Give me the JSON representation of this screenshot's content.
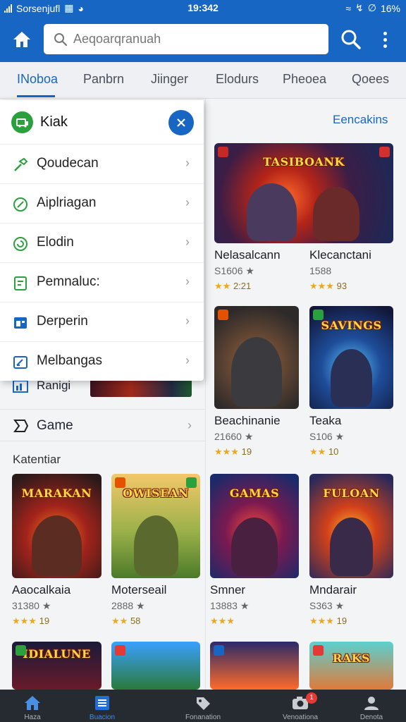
{
  "status_bar": {
    "carrier": "Sorsenjufl",
    "time": "19:342",
    "battery": "16%"
  },
  "search": {
    "placeholder": "Aeqoarqranuah"
  },
  "tabs": [
    {
      "label": "INoboa",
      "active": true
    },
    {
      "label": "Panbrn"
    },
    {
      "label": "Jiinger"
    },
    {
      "label": "Elodurs"
    },
    {
      "label": "Pheoea"
    },
    {
      "label": "Qoees"
    }
  ],
  "dropdown": {
    "title": "Kiak",
    "items": [
      {
        "label": "Qoudecan",
        "icon": "hammer-icon"
      },
      {
        "label": "Aiplriagan",
        "icon": "slash-circle-icon"
      },
      {
        "label": "Elodin",
        "icon": "refresh-circle-icon"
      },
      {
        "label": "Pemnaluc:",
        "icon": "document-icon"
      },
      {
        "label": "Derperin",
        "icon": "window-icon"
      },
      {
        "label": "Melbangas",
        "icon": "edit-icon"
      }
    ]
  },
  "left_list": {
    "partial_label": "Ranigi",
    "game_label": "Game",
    "section_heading": "Katentiar"
  },
  "right_header": {
    "link": "Eencakins"
  },
  "top_cards": [
    {
      "name": "Nelasalcann",
      "num": "S1606",
      "rating": "2:21",
      "thumb_title": "TASIBOANK",
      "stars": 2
    },
    {
      "name": "Klecanctani",
      "num": "1588",
      "rating": "93",
      "thumb_title": "",
      "stars": 3
    },
    {
      "name": "Beachinanie",
      "num": "21660",
      "rating": "19",
      "thumb_title": "",
      "stars": 3
    },
    {
      "name": "Teaka",
      "num": "S106",
      "rating": "10",
      "thumb_title": "SAVINGS",
      "stars": 2
    }
  ],
  "grid_cards": [
    {
      "name": "Aaocalkaia",
      "num": "31380",
      "rating": "19",
      "thumb_title": "MARAKAN",
      "stars": 3
    },
    {
      "name": "Moterseail",
      "num": "2888",
      "rating": "58",
      "thumb_title": "OWISEAN",
      "stars": 2
    },
    {
      "name": "Smner",
      "num": "13883",
      "rating": "",
      "thumb_title": "GAMAS",
      "stars": 3
    },
    {
      "name": "Mndarair",
      "num": "S363",
      "rating": "19",
      "thumb_title": "FULOAN",
      "stars": 3
    }
  ],
  "bottom_row_titles": [
    "IDIALUNE",
    "",
    "",
    "RAKS"
  ],
  "bottom_nav": [
    {
      "label": "Haza",
      "icon": "home-icon"
    },
    {
      "label": "Buacion",
      "icon": "list-icon",
      "active": true
    },
    {
      "label": "Fonanation",
      "icon": "tag-icon"
    },
    {
      "label": "Venoationa",
      "icon": "camera-icon",
      "badge": "1"
    },
    {
      "label": "Denota",
      "icon": "profile-icon"
    }
  ],
  "colors": {
    "primary": "#1766c4",
    "accent_green": "#2aa13c",
    "star": "#f0a81a",
    "nav_bg": "#262a31"
  }
}
